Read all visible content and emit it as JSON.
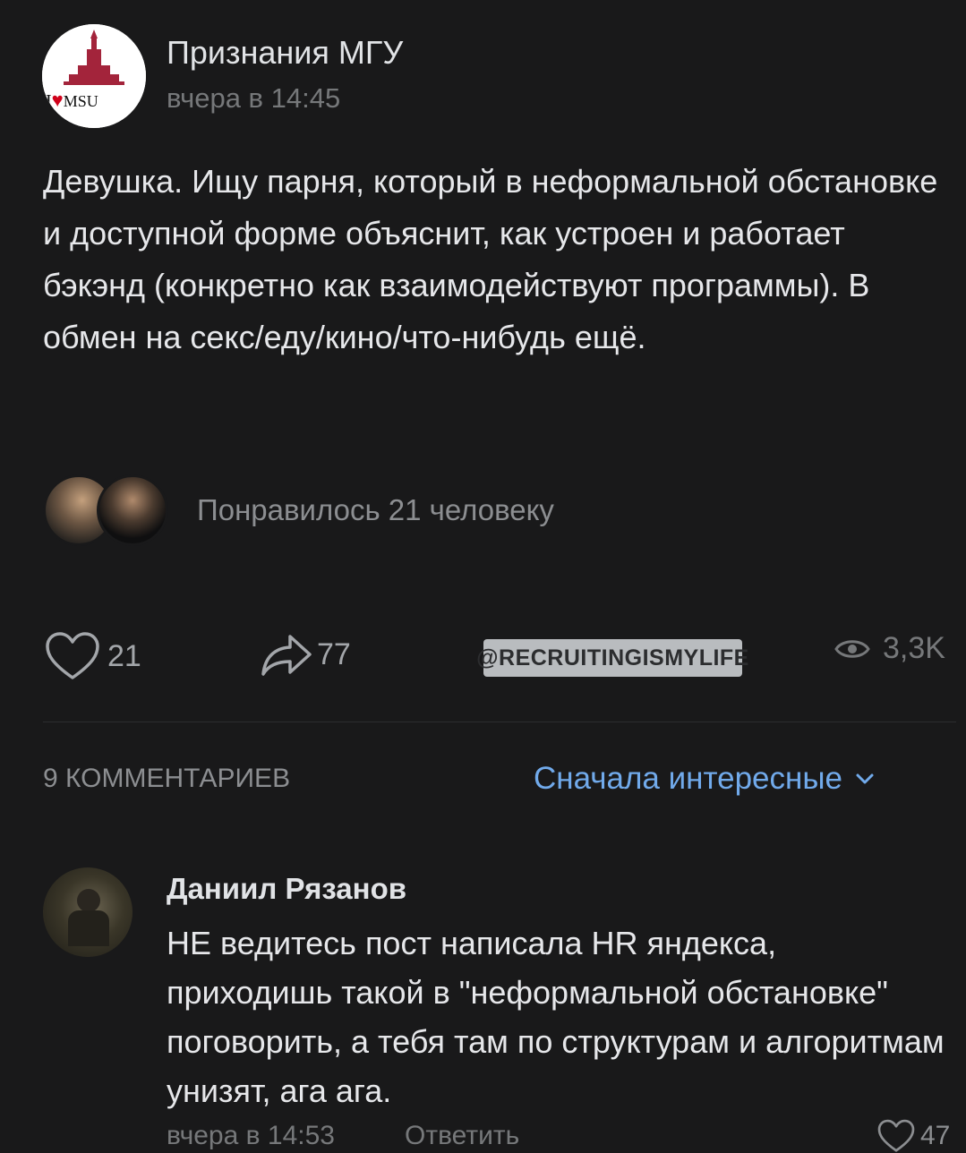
{
  "post": {
    "author": "Признания МГУ",
    "time": "вчера в 14:45",
    "logo_text": "I ♥ MSU",
    "text": "Девушка. Ищу парня, который в неформальной обстановке и доступной форме объяснит, как устроен и работает бэкэнд (конкретно как взаимодействуют программы). В обмен на секс/еду/кино/что-нибудь ещё.",
    "liked_by": "Понравилось 21 человеку"
  },
  "actions": {
    "likes": "21",
    "shares": "77",
    "views": "3,3K",
    "like_icon": "heart-icon",
    "share_icon": "share-icon",
    "view_icon": "eye-icon"
  },
  "watermark": "@RECRUITINGISMYLIFE",
  "comments": {
    "count_label": "9 КОММЕНТАРИЕВ",
    "sort_label": "Сначала интересные",
    "items": [
      {
        "author": "Даниил Рязанов",
        "text": "НЕ ведитесь пост написала HR яндекса, приходишь такой в \"неформальной обстановке\" поговорить, а тебя там по структурам и алгоритмам унизят, ага ага.",
        "time": "вчера в 14:53",
        "reply_label": "Ответить",
        "likes": "47"
      }
    ]
  },
  "colors": {
    "background": "#19191a",
    "accent": "#71aaeb",
    "secondary_text": "#76787a",
    "logo_heart": "#d0021b"
  }
}
